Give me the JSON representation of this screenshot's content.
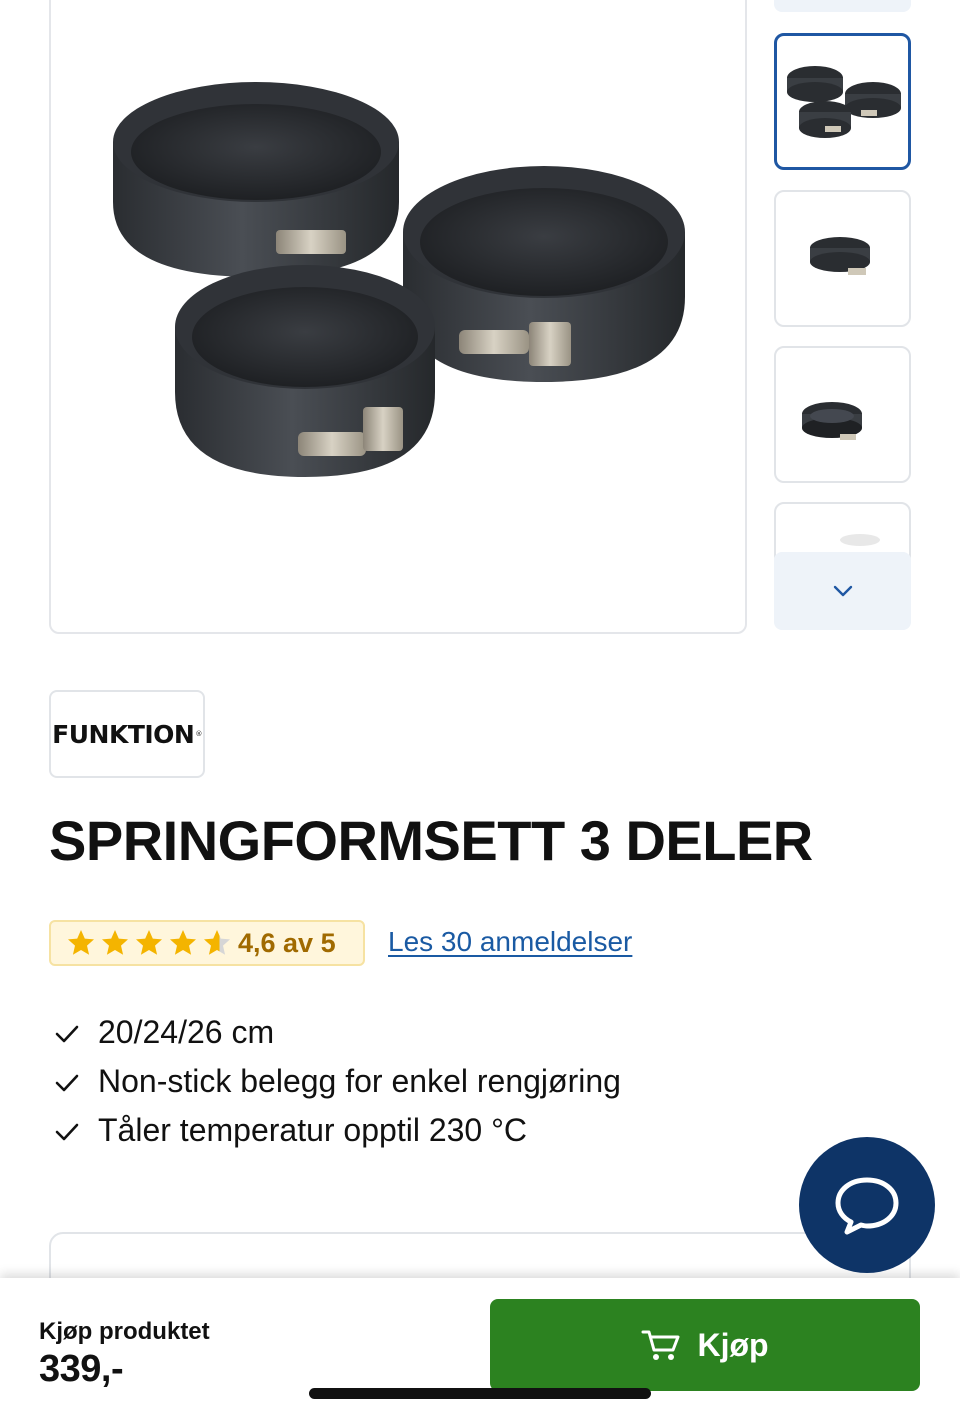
{
  "product": {
    "brand": "FUNKTION",
    "title": "SPRINGFORMSETT 3 DELER"
  },
  "gallery": {
    "main_image": "springform-set-photo",
    "thumbnails": [
      "springform-set-3-pans",
      "single-springform",
      "stacked-springforms",
      "springform-partial"
    ],
    "selected_index": 0
  },
  "rating": {
    "value": 4.6,
    "max": 5,
    "text": "4,6 av 5",
    "reviews_link": "Les 30 anmeldelser"
  },
  "features": [
    "20/24/26 cm",
    "Non-stick belegg for enkel rengjøring",
    "Tåler temperatur opptil 230 °C"
  ],
  "purchase": {
    "label": "Kjøp produktet",
    "price": "339,-",
    "button": "Kjøp"
  },
  "icons": {
    "check": "check-icon",
    "chat": "chat-bubble-icon",
    "cart": "cart-icon",
    "chevron": "chevron-down-icon"
  },
  "colors": {
    "accent_blue": "#1f57a3",
    "link_blue": "#1a5aa3",
    "buy_green": "#2c8220",
    "chat_navy": "#0e3467",
    "star_gold": "#f4b400",
    "rating_bg": "#fff6dc"
  }
}
